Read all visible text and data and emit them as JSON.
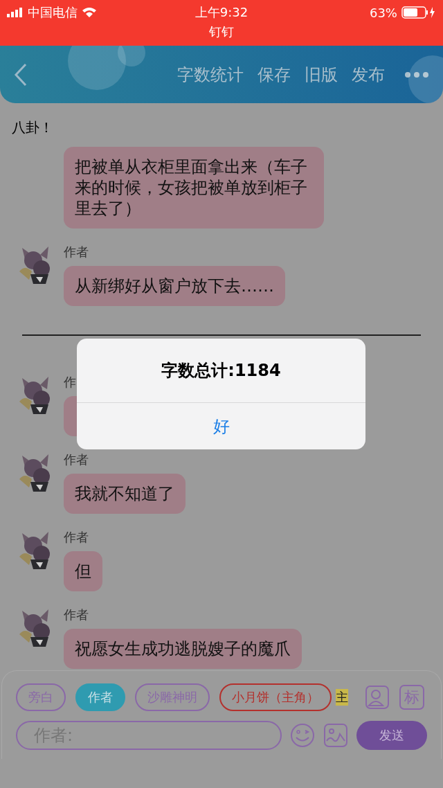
{
  "status_bar": {
    "carrier": "中国电信",
    "time": "上午9:32",
    "battery": "63%",
    "app": "钉钉"
  },
  "header": {
    "actions": [
      "字数统计",
      "保存",
      "旧版",
      "发布"
    ]
  },
  "title": "八卦！",
  "messages": [
    {
      "kind": "message",
      "text": "把被单从衣柜里面拿出来（车子来的时候，女孩把被单放到柜子里去了）"
    },
    {
      "kind": "message",
      "sender": "作者",
      "text": "从新绑好从窗户放下去……"
    },
    {
      "kind": "divider"
    },
    {
      "kind": "message",
      "sender": "作"
    },
    {
      "kind": "message",
      "sender": "作者",
      "text": "我就不知道了"
    },
    {
      "kind": "message",
      "sender": "作者",
      "text": "但"
    },
    {
      "kind": "message",
      "sender": "作者",
      "text": "祝愿女生成功逃脱嫂子的魔爪"
    }
  ],
  "roles": [
    {
      "label": "旁白",
      "selected": false,
      "color": "#8a68a8"
    },
    {
      "label": "作者",
      "selected": true,
      "color": "#2f9bb0"
    },
    {
      "label": "沙雕神明",
      "selected": false,
      "color": "#8a68a8"
    },
    {
      "label": "小月饼（主角）",
      "selected": false,
      "color": "#b4302c"
    }
  ],
  "role_fragment": "主",
  "tag_button": "标",
  "input": {
    "placeholder": "作者:"
  },
  "send_button": "发送",
  "dialog": {
    "message": "字数总计:1184",
    "button": "好"
  }
}
